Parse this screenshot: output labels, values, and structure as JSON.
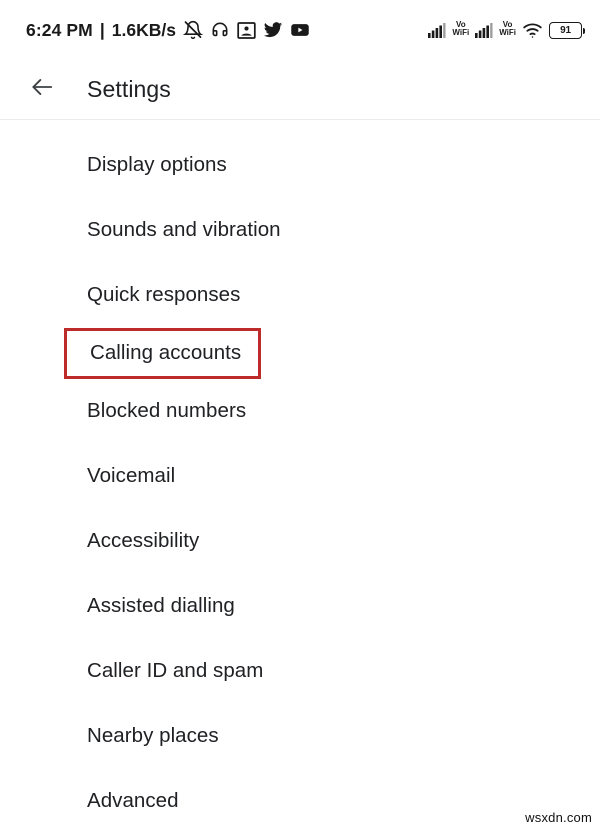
{
  "status_bar": {
    "clock": "6:24 PM",
    "separator": "|",
    "network_speed": "1.6KB/s",
    "left_icons": [
      {
        "name": "bell-muted-icon",
        "label": "Notifications silenced"
      },
      {
        "name": "headphones-icon",
        "label": "Headset connected"
      },
      {
        "name": "photo-icon",
        "label": "Screenshot"
      },
      {
        "name": "twitter-icon",
        "label": "Twitter"
      },
      {
        "name": "youtube-icon",
        "label": "YouTube"
      }
    ],
    "right_icons": [
      {
        "name": "signal-bars-icon",
        "label": "SIM 1 signal"
      },
      {
        "name": "vowifi-indicator",
        "line1": "Vo",
        "line2": "WiFi"
      },
      {
        "name": "signal-bars-icon",
        "label": "SIM 2 signal"
      },
      {
        "name": "vowifi-indicator",
        "line1": "Vo",
        "line2": "WiFi"
      },
      {
        "name": "wifi-icon",
        "label": "Wi-Fi connected"
      }
    ],
    "battery": {
      "level": "91"
    }
  },
  "app_bar": {
    "back_icon": "arrow-left-icon",
    "title": "Settings"
  },
  "settings_list": {
    "items": [
      {
        "label": "Display options",
        "highlighted": false
      },
      {
        "label": "Sounds and vibration",
        "highlighted": false
      },
      {
        "label": "Quick responses",
        "highlighted": false
      },
      {
        "label": "Calling accounts",
        "highlighted": true
      },
      {
        "label": "Blocked numbers",
        "highlighted": false
      },
      {
        "label": "Voicemail",
        "highlighted": false
      },
      {
        "label": "Accessibility",
        "highlighted": false
      },
      {
        "label": "Assisted dialling",
        "highlighted": false
      },
      {
        "label": "Caller ID and spam",
        "highlighted": false
      },
      {
        "label": "Nearby places",
        "highlighted": false
      },
      {
        "label": "Advanced",
        "highlighted": false
      }
    ]
  },
  "annotation": {
    "highlight_color": "#be2b2b",
    "target_label": "Calling accounts"
  },
  "watermark": {
    "text": "wsxdn.com"
  }
}
